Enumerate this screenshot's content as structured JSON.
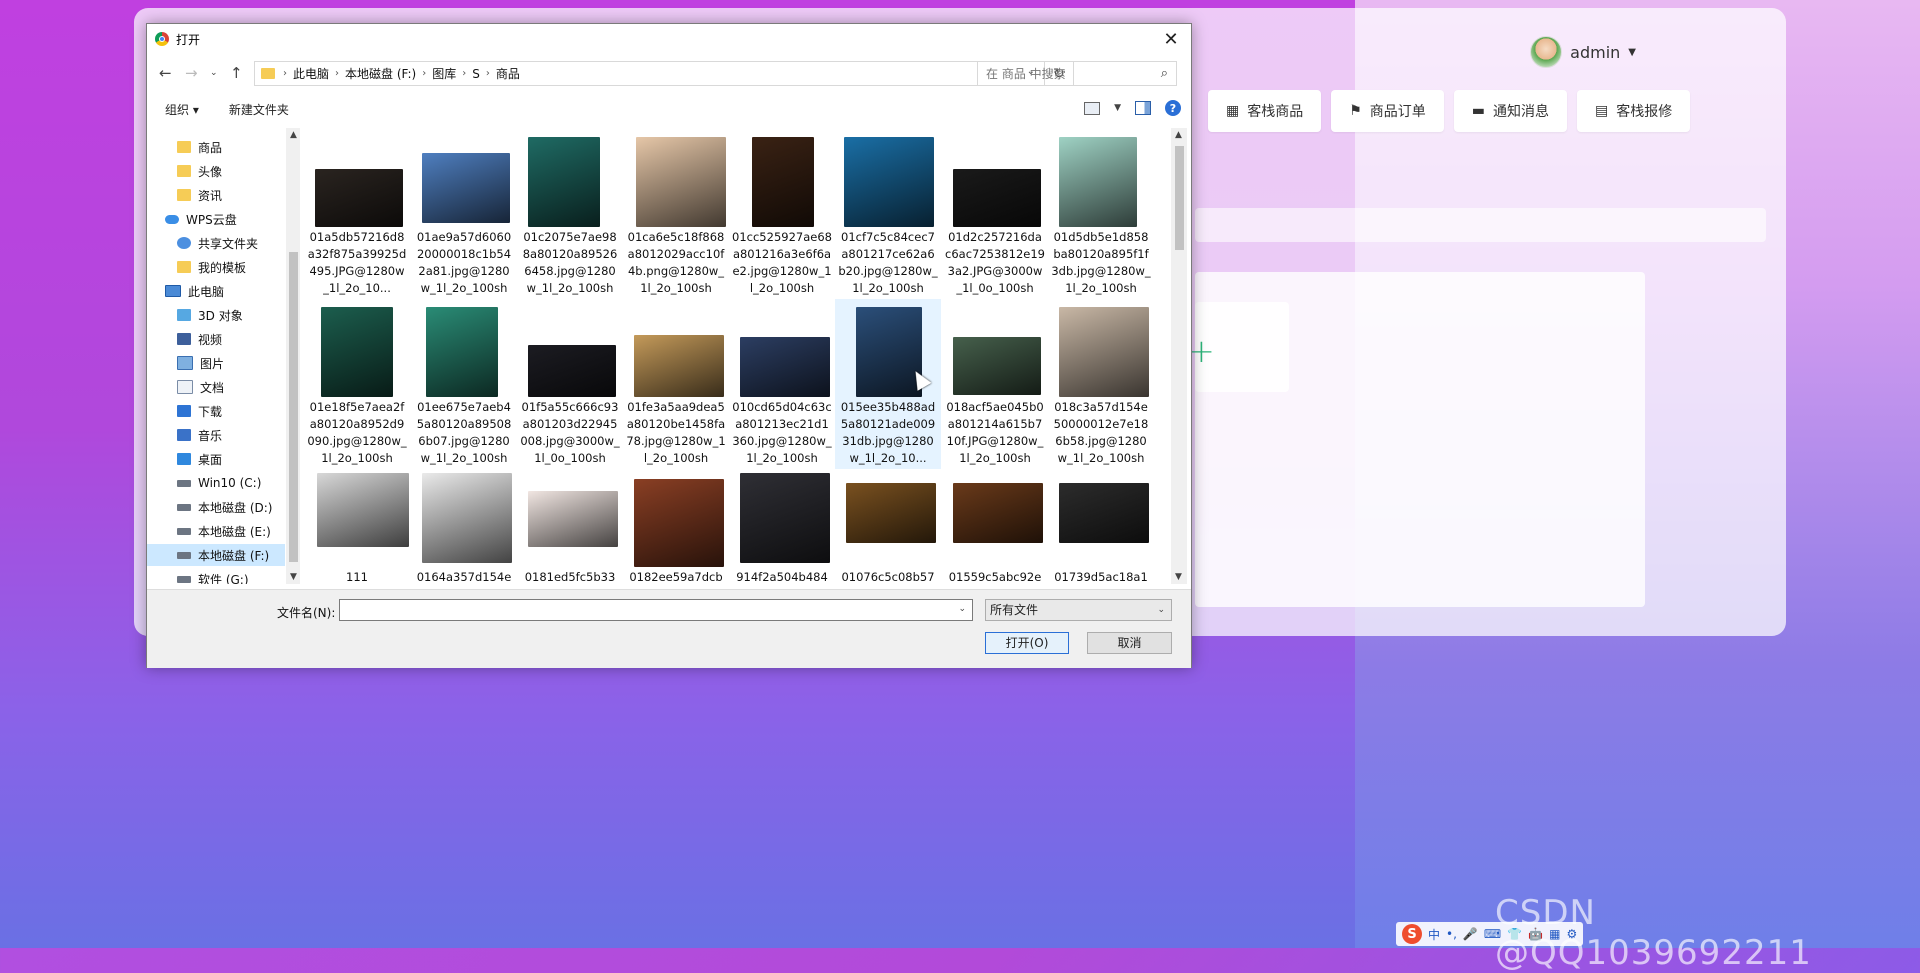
{
  "app": {
    "user_name": "admin",
    "nav": [
      {
        "label": "客栈商品",
        "icon": "grid-icon"
      },
      {
        "label": "商品订单",
        "icon": "flag-icon"
      },
      {
        "label": "通知消息",
        "icon": "monitor-icon"
      },
      {
        "label": "客栈报修",
        "icon": "clipboard-icon"
      }
    ]
  },
  "dialog": {
    "title": "打开",
    "close": "✕",
    "breadcrumb": [
      "此电脑",
      "本地磁盘 (F:)",
      "图库",
      "S",
      "商品"
    ],
    "search_placeholder": "在 商品 中搜索",
    "toolbar": {
      "organize": "组织 ▾",
      "new_folder": "新建文件夹",
      "help": "?"
    },
    "tree": [
      {
        "label": "商品",
        "icon": "folder-icon",
        "selected": false
      },
      {
        "label": "头像",
        "icon": "folder-icon",
        "selected": false
      },
      {
        "label": "资讯",
        "icon": "folder-icon",
        "selected": false
      },
      {
        "label": "WPS云盘",
        "icon": "cloud-icon",
        "selected": false
      },
      {
        "label": "共享文件夹",
        "icon": "share-icon",
        "selected": false
      },
      {
        "label": "我的模板",
        "icon": "folder-icon",
        "selected": false
      },
      {
        "label": "此电脑",
        "icon": "pc-icon",
        "selected": false
      },
      {
        "label": "3D 对象",
        "icon": "cube-icon",
        "selected": false
      },
      {
        "label": "视频",
        "icon": "video-icon",
        "selected": false
      },
      {
        "label": "图片",
        "icon": "picture-icon",
        "selected": false
      },
      {
        "label": "文档",
        "icon": "document-icon",
        "selected": false
      },
      {
        "label": "下载",
        "icon": "download-icon",
        "selected": false
      },
      {
        "label": "音乐",
        "icon": "music-icon",
        "selected": false
      },
      {
        "label": "桌面",
        "icon": "desktop-icon",
        "selected": false
      },
      {
        "label": "Win10 (C:)",
        "icon": "drive-icon",
        "selected": false
      },
      {
        "label": "本地磁盘 (D:)",
        "icon": "drive-icon",
        "selected": false
      },
      {
        "label": "本地磁盘 (E:)",
        "icon": "drive-icon",
        "selected": false
      },
      {
        "label": "本地磁盘 (F:)",
        "icon": "drive-icon",
        "selected": true
      },
      {
        "label": "软件 (G:)",
        "icon": "drive-icon",
        "selected": false
      }
    ],
    "files": [
      {
        "name": "01a5db57216d8a32f875a39925d495.JPG@1280w_1l_2o_10...",
        "color": "#2a2420",
        "selected": false
      },
      {
        "name": "01ae9a57d606020000018c1b542a81.jpg@1280w_1l_2o_100sh",
        "color": "#4f7fc0",
        "selected": false
      },
      {
        "name": "01c2075e7ae988a80120a895266458.jpg@1280w_1l_2o_100sh",
        "color": "#1f6b64",
        "selected": false
      },
      {
        "name": "01ca6e5c18f868a8012029acc10f4b.png@1280w_1l_2o_100sh",
        "color": "#e6c7a8",
        "selected": false
      },
      {
        "name": "01cc525927ae68a801216a3e6f6ae2.jpg@1280w_1l_2o_100sh",
        "color": "#3a2214",
        "selected": false
      },
      {
        "name": "01cf7c5c84cec7a801217ce62a6b20.jpg@1280w_1l_2o_100sh",
        "color": "#1a6fa6",
        "selected": false
      },
      {
        "name": "01d2c257216dac6ac7253812e193a2.JPG@3000w_1l_0o_100sh",
        "color": "#1a1a1a",
        "selected": false
      },
      {
        "name": "01d5db5e1d858ba80120a895f1f3db.jpg@1280w_1l_2o_100sh",
        "color": "#9fd2c4",
        "selected": false
      },
      {
        "name": "01e18f5e7aea2fa80120a8952d9090.jpg@1280w_1l_2o_100sh",
        "color": "#1c5e4e",
        "selected": false
      },
      {
        "name": "01ee675e7aeb45a80120a895086b07.jpg@1280w_1l_2o_100sh",
        "color": "#2a8c76",
        "selected": false
      },
      {
        "name": "01f5a55c666c93a801203d22945008.jpg@3000w_1l_0o_100sh",
        "color": "#1c1c22",
        "selected": false
      },
      {
        "name": "01fe3a5aa9dea5a80120be1458fa78.jpg@1280w_1l_2o_100sh",
        "color": "#c49a5a",
        "selected": false
      },
      {
        "name": "010cd65d04c63ca801213ec21d1360.jpg@1280w_1l_2o_100sh",
        "color": "#2c3e62",
        "selected": false
      },
      {
        "name": "015ee35b488ad5a80121ade00931db.jpg@1280w_1l_2o_10...",
        "color": "#2b4f7a",
        "selected": true
      },
      {
        "name": "018acf5ae045b0a801214a615b710f.JPG@1280w_1l_2o_100sh",
        "color": "#46604c",
        "selected": false
      },
      {
        "name": "018c3a57d154e50000012e7e186b58.jpg@1280w_1l_2o_100sh",
        "color": "#c9b8a6",
        "selected": false
      },
      {
        "name": "111",
        "color": "#d8d8d8",
        "selected": false
      },
      {
        "name": "0164a357d154e",
        "color": "#eaeaea",
        "selected": false
      },
      {
        "name": "0181ed5fc5b33",
        "color": "#f1e6e2",
        "selected": false
      },
      {
        "name": "0182ee59a7dcb",
        "color": "#8a3f24",
        "selected": false
      },
      {
        "name": "914f2a504b484",
        "color": "#2f2f35",
        "selected": false
      },
      {
        "name": "01076c5c08b57",
        "color": "#7a5120",
        "selected": false
      },
      {
        "name": "01559c5abc92e",
        "color": "#6a3a1a",
        "selected": false
      },
      {
        "name": "01739d5ac18a1",
        "color": "#2c2c2c",
        "selected": false
      }
    ],
    "filename_label": "文件名(N):",
    "filename_value": "",
    "filetype": "所有文件",
    "open_button": "打开(O)",
    "cancel_button": "取消"
  },
  "taskbar": {
    "ime_logo": "S",
    "ime_items": [
      "中",
      "•,",
      "🎤",
      "⌨",
      "👕",
      "🤖",
      "▦",
      "⚙"
    ]
  },
  "watermark": "CSDN @QQ1039692211"
}
